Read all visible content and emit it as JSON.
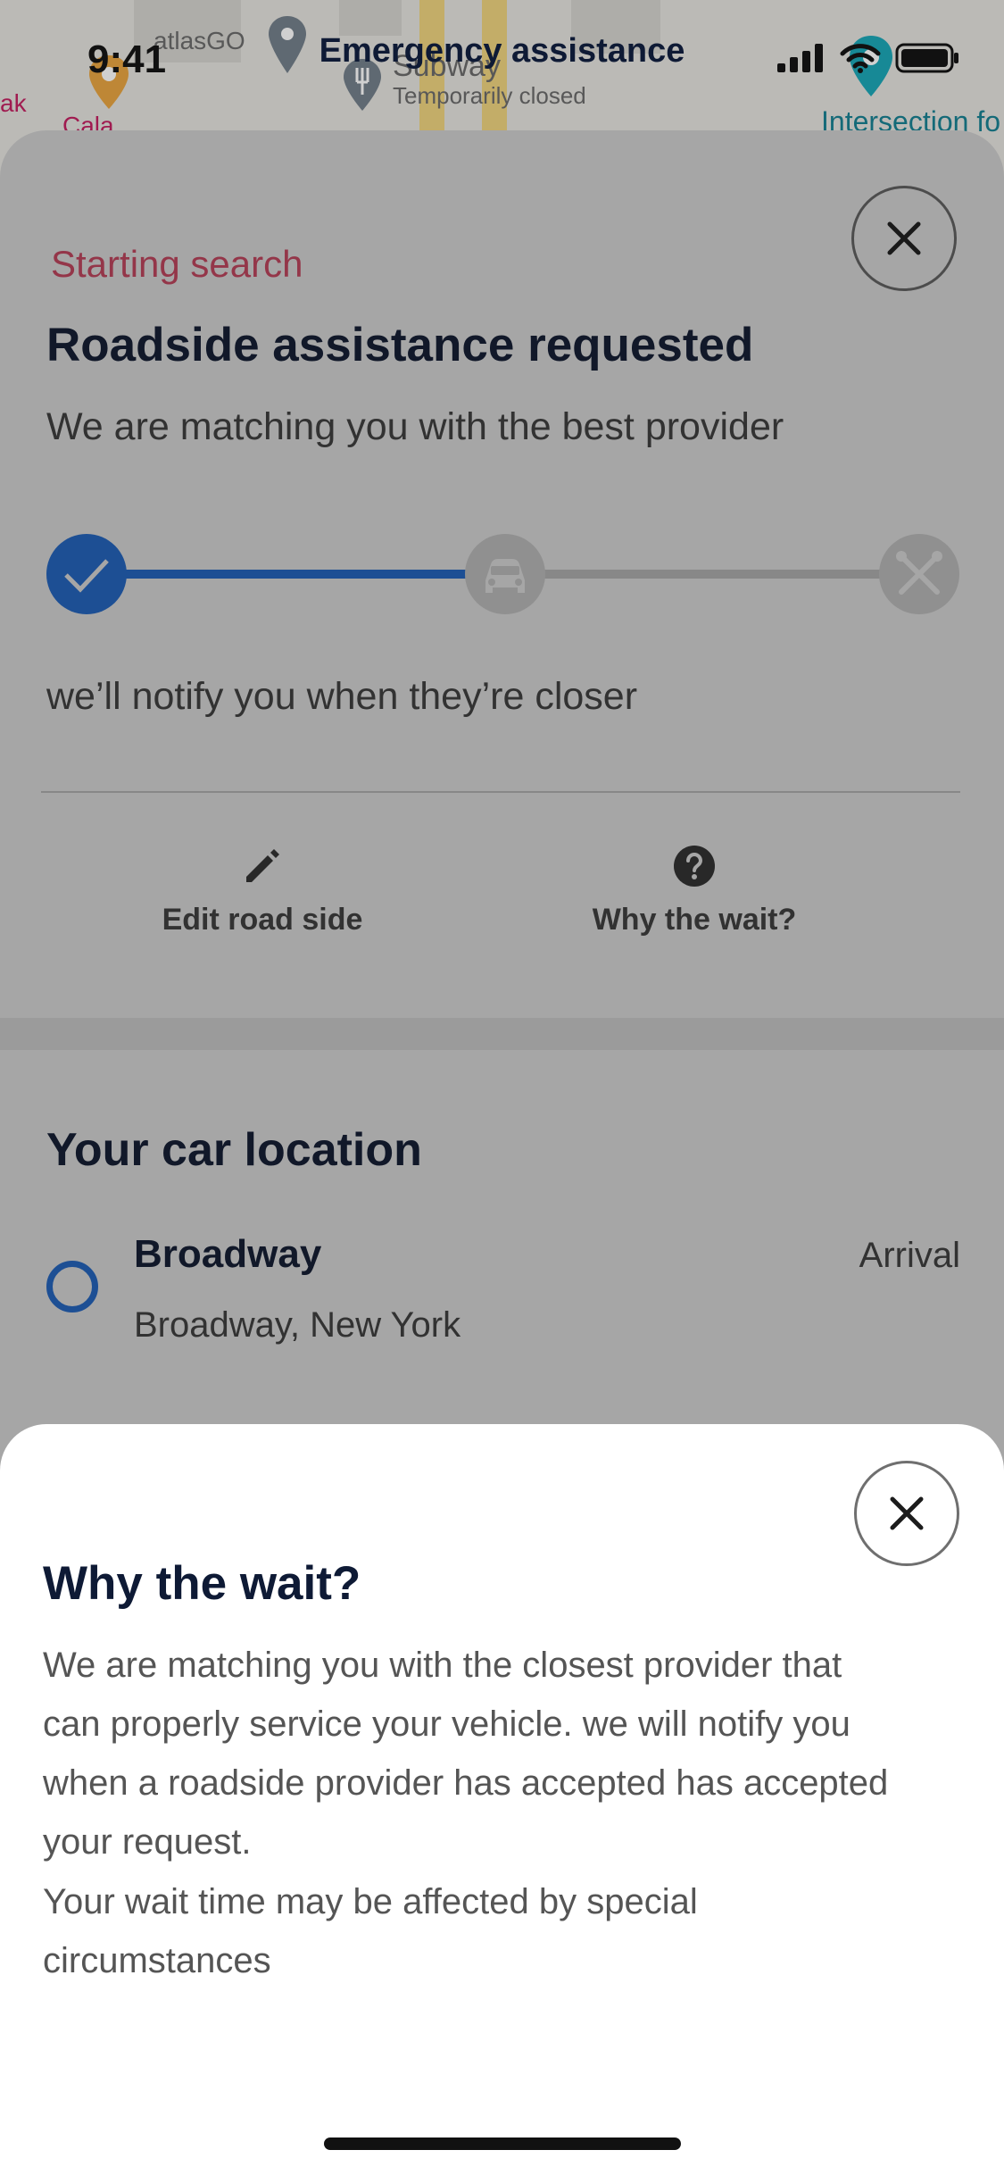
{
  "status_bar": {
    "time": "9:41",
    "title": "Emergency assistance"
  },
  "map": {
    "labels": {
      "poi1": "atlasGO",
      "poi2": "Subway",
      "poi2_sub": "Temporarily closed",
      "left1": "ak",
      "left2": "Cala",
      "right": "Intersection fo"
    }
  },
  "card": {
    "status_label": "Starting search",
    "title": "Roadside assistance requested",
    "subtitle": "We are matching you with the best provider",
    "progress_steps": [
      {
        "icon": "check-icon",
        "state": "done"
      },
      {
        "icon": "car-icon",
        "state": "pending"
      },
      {
        "icon": "tools-icon",
        "state": "pending"
      }
    ],
    "progress_complete_fraction": 0.5,
    "notify_text": "we’ll notify you when they’re closer",
    "actions": [
      {
        "label": "Edit road side",
        "icon": "pencil-icon"
      },
      {
        "label": "Why the wait?",
        "icon": "question-icon"
      }
    ],
    "location_heading": "Your car location",
    "location": {
      "name": "Broadway",
      "address": "Broadway, New York",
      "tag": "Arrival"
    }
  },
  "sheet": {
    "title": "Why the wait?",
    "paragraph1": "We are matching you with the closest provider that can properly service your vehicle. we will notify you when a roadside provider has accepted has accepted your request.",
    "paragraph2": "Your wait time may be affected by special circumstances"
  },
  "colors": {
    "accent": "#2273e4",
    "status": "#e24a6a",
    "heading": "#0e1a35"
  }
}
